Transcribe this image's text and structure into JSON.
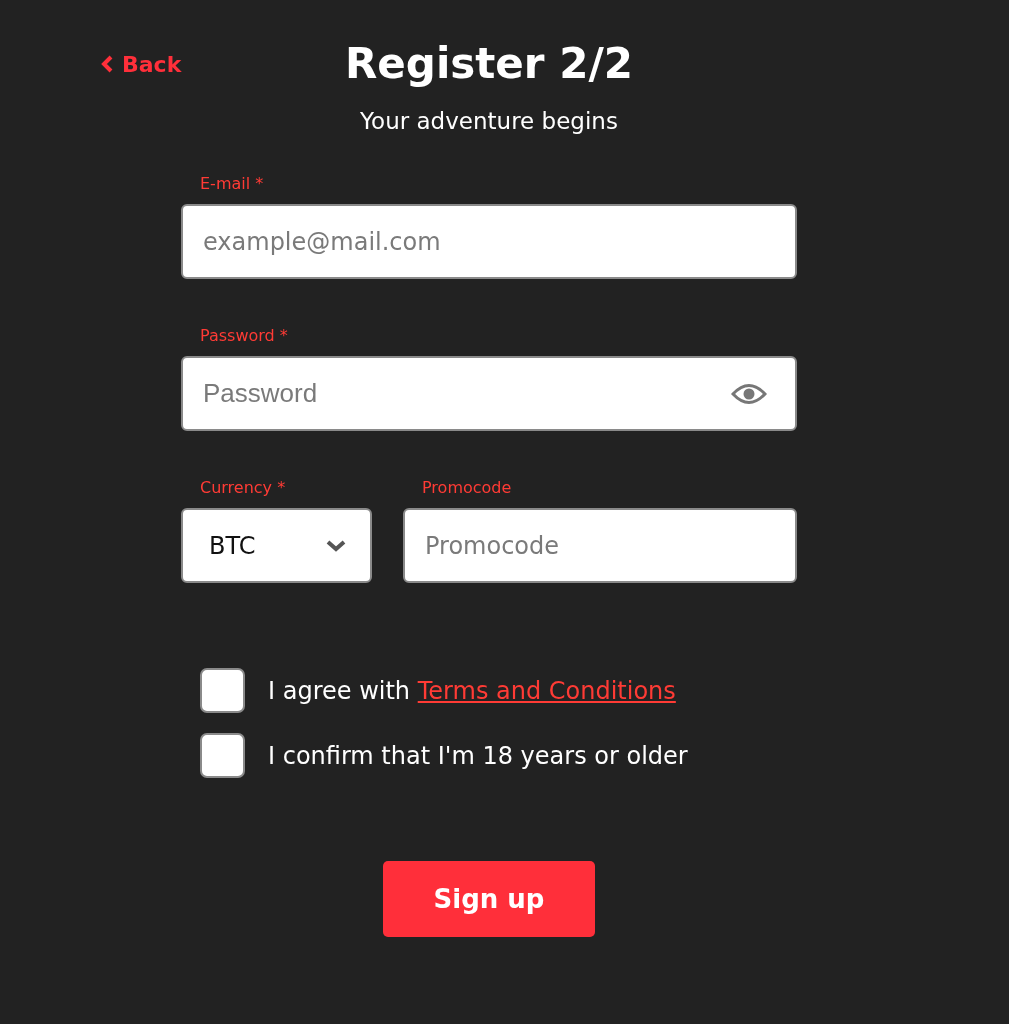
{
  "header": {
    "back": "Back",
    "title": "Register 2/2",
    "subtitle": "Your adventure begins"
  },
  "fields": [
    {
      "kind": "text",
      "label": "E-mail *",
      "placeholder": "example@mail.com"
    },
    {
      "kind": "password",
      "label": "Password *",
      "placeholder": "Password"
    }
  ],
  "currency": {
    "label": "Currency *",
    "value": "BTC"
  },
  "promocode": {
    "label": "Promocode",
    "placeholder": "Promocode"
  },
  "checkboxes": [
    {
      "text": "I agree with ",
      "link": "Terms and Conditions",
      "checked": false
    },
    {
      "text": "I confirm that I'm 18 years or older",
      "checked": false
    }
  ],
  "submit": "Sign up"
}
